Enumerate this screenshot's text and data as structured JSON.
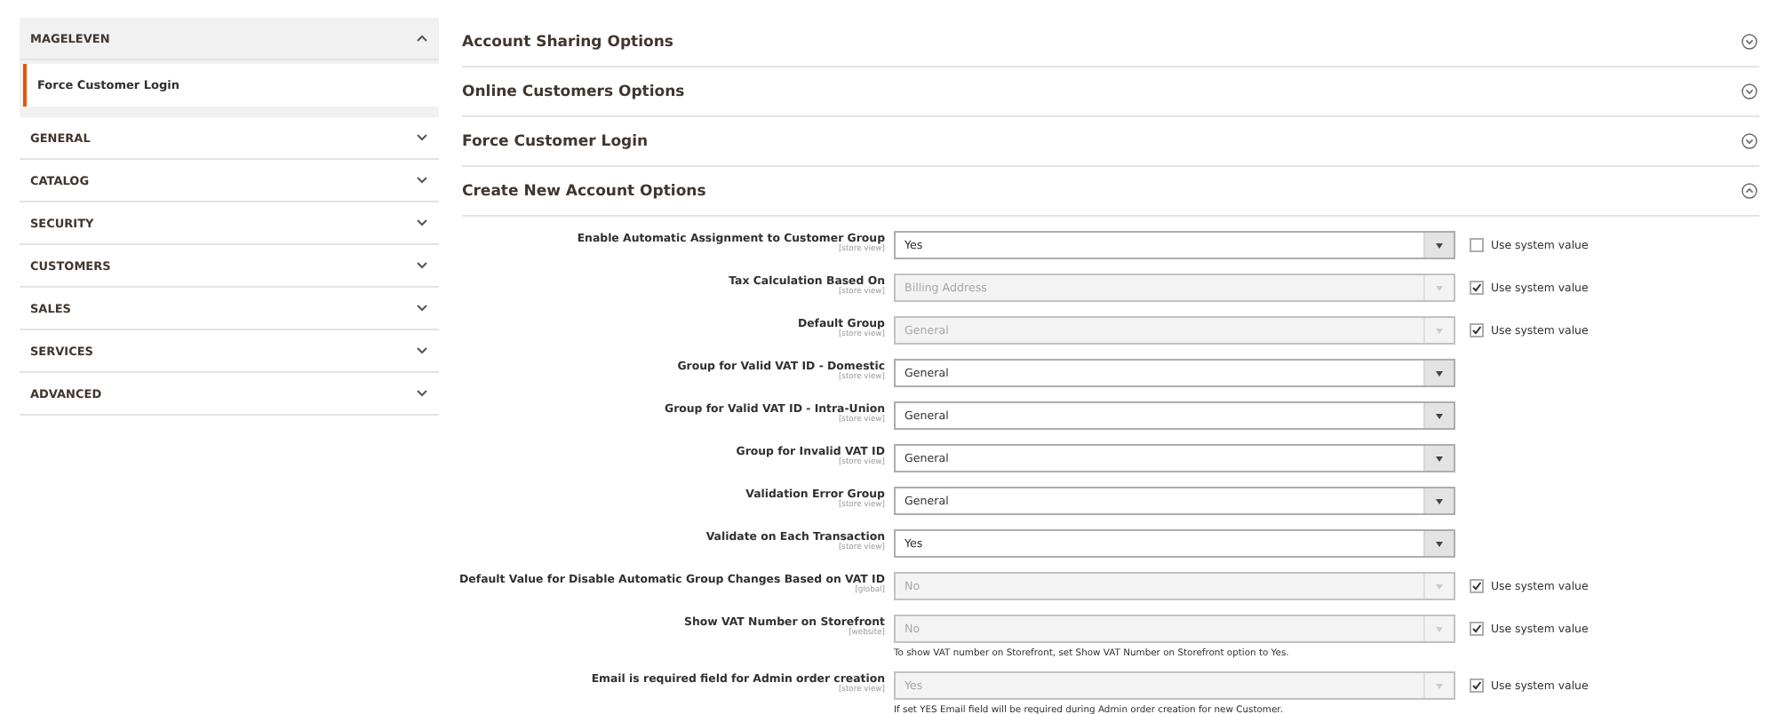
{
  "sidebar": {
    "groups": [
      {
        "title": "MAGELEVEN",
        "expanded": true,
        "items": [
          {
            "label": "Force Customer Login",
            "selected": true
          }
        ]
      },
      {
        "title": "GENERAL",
        "expanded": false
      },
      {
        "title": "CATALOG",
        "expanded": false
      },
      {
        "title": "SECURITY",
        "expanded": false
      },
      {
        "title": "CUSTOMERS",
        "expanded": false
      },
      {
        "title": "SALES",
        "expanded": false
      },
      {
        "title": "SERVICES",
        "expanded": false
      },
      {
        "title": "ADVANCED",
        "expanded": false
      }
    ]
  },
  "sections": [
    {
      "title": "Account Sharing Options",
      "expanded": false
    },
    {
      "title": "Online Customers Options",
      "expanded": false
    },
    {
      "title": "Force Customer Login",
      "expanded": false
    },
    {
      "title": "Create New Account Options",
      "expanded": true,
      "fields": [
        {
          "label": "Enable Automatic Assignment to Customer Group",
          "scope": "[store view]",
          "value": "Yes",
          "disabled": false,
          "system": {
            "label": "Use system value",
            "checked": false
          }
        },
        {
          "label": "Tax Calculation Based On",
          "scope": "[store view]",
          "value": "Billing Address",
          "disabled": true,
          "system": {
            "label": "Use system value",
            "checked": true
          }
        },
        {
          "label": "Default Group",
          "scope": "[store view]",
          "value": "General",
          "disabled": true,
          "system": {
            "label": "Use system value",
            "checked": true
          }
        },
        {
          "label": "Group for Valid VAT ID - Domestic",
          "scope": "[store view]",
          "value": "General",
          "disabled": false
        },
        {
          "label": "Group for Valid VAT ID - Intra-Union",
          "scope": "[store view]",
          "value": "General",
          "disabled": false
        },
        {
          "label": "Group for Invalid VAT ID",
          "scope": "[store view]",
          "value": "General",
          "disabled": false
        },
        {
          "label": "Validation Error Group",
          "scope": "[store view]",
          "value": "General",
          "disabled": false
        },
        {
          "label": "Validate on Each Transaction",
          "scope": "[store view]",
          "value": "Yes",
          "disabled": false
        },
        {
          "label": "Default Value for Disable Automatic Group Changes Based on VAT ID",
          "scope": "[global]",
          "value": "No",
          "disabled": true,
          "system": {
            "label": "Use system value",
            "checked": true
          }
        },
        {
          "label": "Show VAT Number on Storefront",
          "scope": "[website]",
          "value": "No",
          "disabled": true,
          "system": {
            "label": "Use system value",
            "checked": true
          },
          "note": "To show VAT number on Storefront, set Show VAT Number on Storefront option to Yes."
        },
        {
          "label": "Email is required field for Admin order creation",
          "scope": "[store view]",
          "value": "Yes",
          "disabled": true,
          "system": {
            "label": "Use system value",
            "checked": true
          },
          "note": "If set YES Email field will be required during Admin order creation for new Customer."
        }
      ]
    }
  ]
}
